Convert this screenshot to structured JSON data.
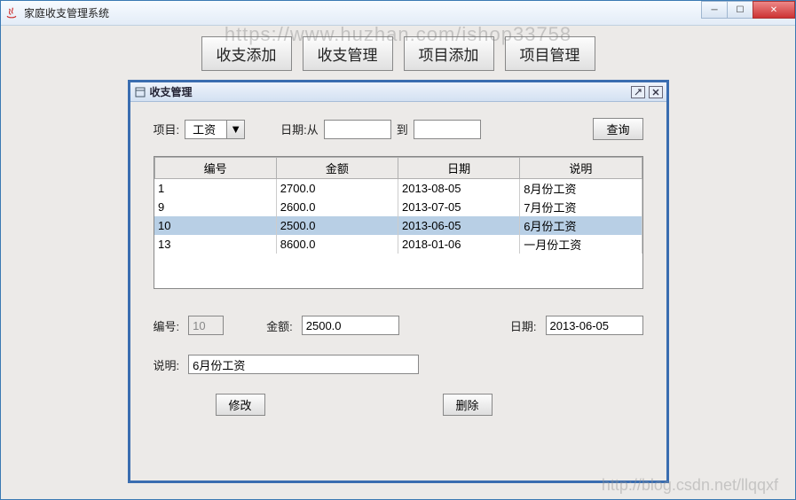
{
  "window": {
    "title": "家庭收支管理系统"
  },
  "toolbar": {
    "add_entry": "收支添加",
    "manage_entry": "收支管理",
    "add_project": "项目添加",
    "manage_project": "项目管理"
  },
  "panel": {
    "title": "收支管理",
    "project_label": "项目:",
    "project_value": "工资",
    "date_from_label": "日期:从",
    "date_to_label": "到",
    "date_from_value": "",
    "date_to_value": "",
    "query_btn": "查询"
  },
  "table": {
    "headers": [
      "编号",
      "金额",
      "日期",
      "说明"
    ],
    "rows": [
      {
        "id": "1",
        "amount": "2700.0",
        "date": "2013-08-05",
        "desc": "8月份工资",
        "selected": false
      },
      {
        "id": "9",
        "amount": "2600.0",
        "date": "2013-07-05",
        "desc": "7月份工资",
        "selected": false
      },
      {
        "id": "10",
        "amount": "2500.0",
        "date": "2013-06-05",
        "desc": "6月份工资",
        "selected": true
      },
      {
        "id": "13",
        "amount": "8600.0",
        "date": "2018-01-06",
        "desc": "一月份工资",
        "selected": false
      }
    ]
  },
  "form": {
    "id_label": "编号:",
    "id_value": "10",
    "amount_label": "金额:",
    "amount_value": "2500.0",
    "date_label": "日期:",
    "date_value": "2013-06-05",
    "desc_label": "说明:",
    "desc_value": "6月份工资",
    "modify_btn": "修改",
    "delete_btn": "删除"
  },
  "watermark": {
    "top": "https://www.huzhan.com/ishop33758",
    "bottom": "http://blog.csdn.net/llqqxf"
  }
}
